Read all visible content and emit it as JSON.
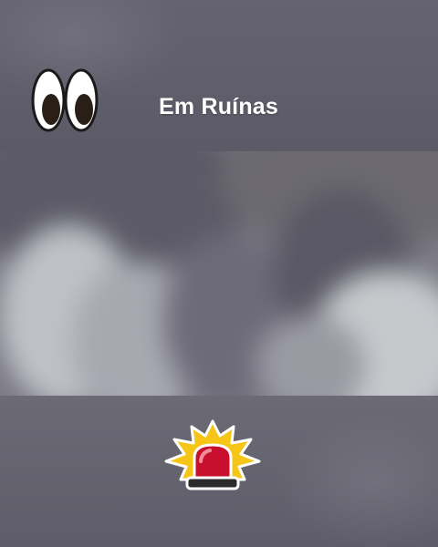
{
  "header": {
    "title": "Em Ruínas",
    "icon": "eyes-icon"
  },
  "video": {
    "state": "blurred"
  },
  "footer": {
    "icon": "police-siren-icon"
  },
  "colors": {
    "title_text": "#ffffff",
    "siren_red": "#c8102e",
    "siren_glow": "#f5c518"
  }
}
